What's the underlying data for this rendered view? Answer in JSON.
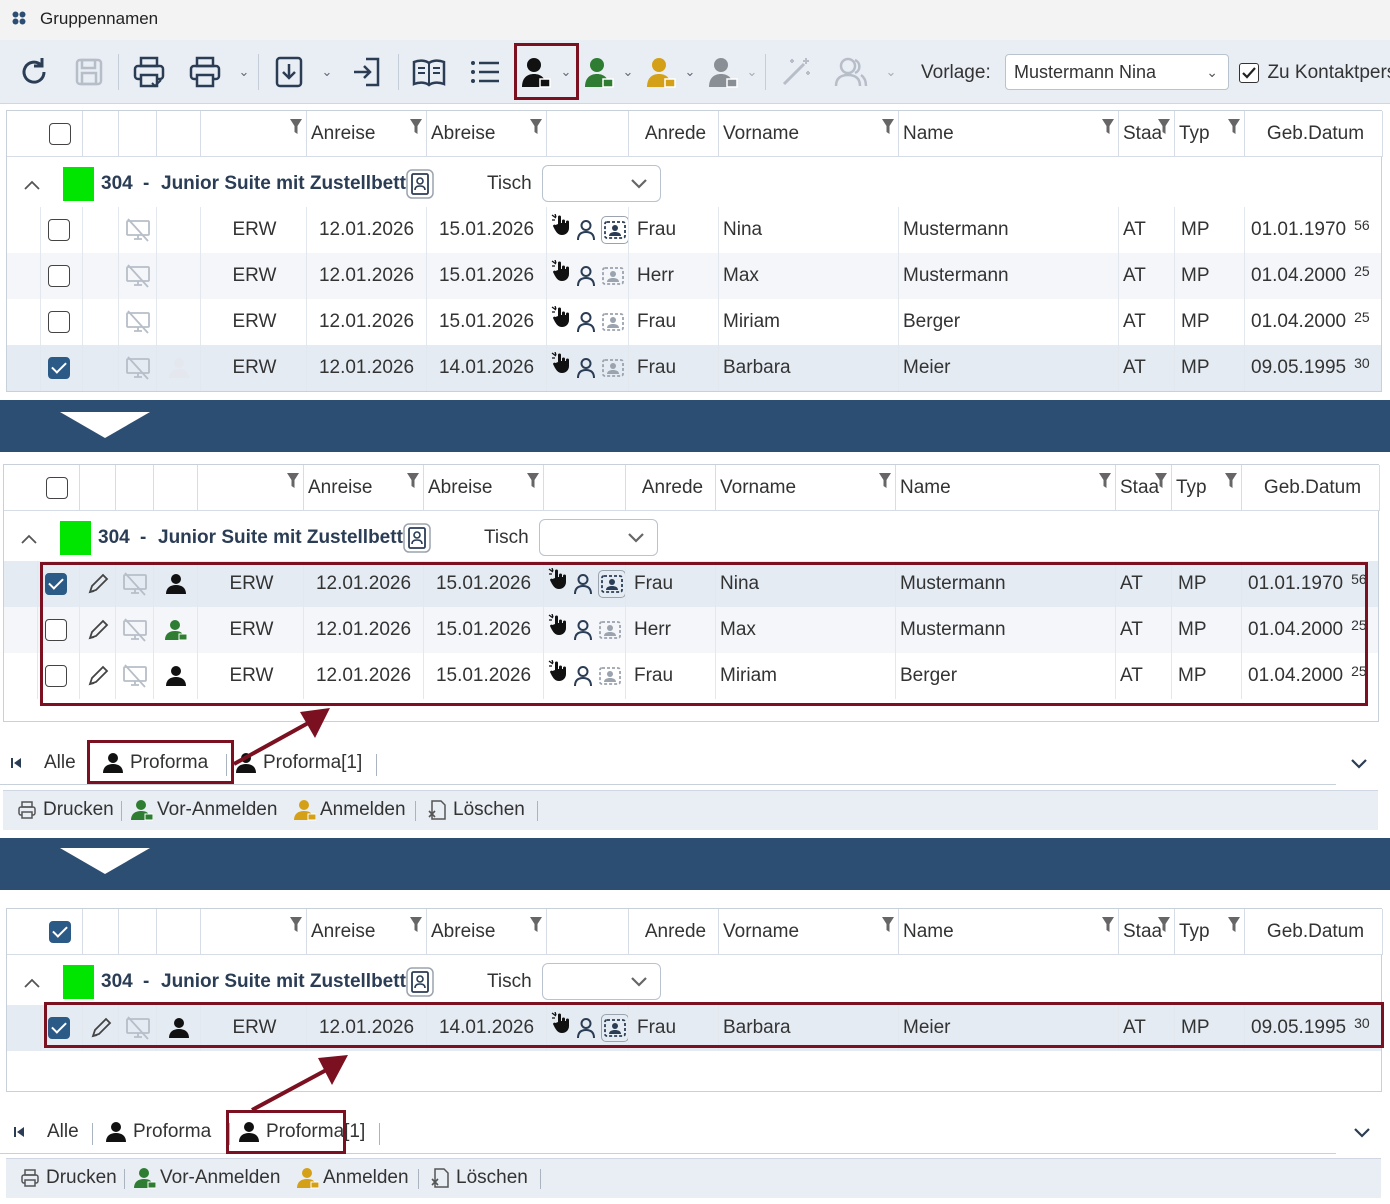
{
  "window": {
    "title": "Gruppennamen"
  },
  "toolbar": {
    "vorlage_label": "Vorlage:",
    "vorlage_value": "Mustermann Nina",
    "contact_label": "Zu Kontaktpers",
    "contact_checked": true
  },
  "columns": [
    "Anreise",
    "Abreise",
    "Anrede",
    "Vorname",
    "Name",
    "Staa",
    "Typ",
    "Geb.Datum"
  ],
  "group": {
    "room": "304",
    "sep": "-",
    "name": "Junior Suite mit Zustellbett",
    "tisch_label": "Tisch",
    "color": "#00e600"
  },
  "panel1": {
    "rows": [
      {
        "checked": false,
        "typ": "ERW",
        "anreise": "12.01.2026",
        "abreise": "15.01.2026",
        "anrede": "Frau",
        "vorname": "Nina",
        "name": "Mustermann",
        "staat": "AT",
        "mp": "MP",
        "geb": "01.01.1970",
        "age": "56"
      },
      {
        "checked": false,
        "typ": "ERW",
        "anreise": "12.01.2026",
        "abreise": "15.01.2026",
        "anrede": "Herr",
        "vorname": "Max",
        "name": "Mustermann",
        "staat": "AT",
        "mp": "MP",
        "geb": "01.04.2000",
        "age": "25"
      },
      {
        "checked": false,
        "typ": "ERW",
        "anreise": "12.01.2026",
        "abreise": "15.01.2026",
        "anrede": "Frau",
        "vorname": "Miriam",
        "name": "Berger",
        "staat": "AT",
        "mp": "MP",
        "geb": "01.04.2000",
        "age": "25"
      },
      {
        "checked": true,
        "typ": "ERW",
        "anreise": "12.01.2026",
        "abreise": "14.01.2026",
        "anrede": "Frau",
        "vorname": "Barbara",
        "name": "Meier",
        "staat": "AT",
        "mp": "MP",
        "geb": "09.05.1995",
        "age": "30"
      }
    ]
  },
  "panel2": {
    "rows": [
      {
        "checked": true,
        "typ": "ERW",
        "anreise": "12.01.2026",
        "abreise": "15.01.2026",
        "anrede": "Frau",
        "vorname": "Nina",
        "name": "Mustermann",
        "staat": "AT",
        "mp": "MP",
        "geb": "01.01.1970",
        "age": "56"
      },
      {
        "checked": false,
        "typ": "ERW",
        "anreise": "12.01.2026",
        "abreise": "15.01.2026",
        "anrede": "Herr",
        "vorname": "Max",
        "name": "Mustermann",
        "staat": "AT",
        "mp": "MP",
        "geb": "01.04.2000",
        "age": "25"
      },
      {
        "checked": false,
        "typ": "ERW",
        "anreise": "12.01.2026",
        "abreise": "15.01.2026",
        "anrede": "Frau",
        "vorname": "Miriam",
        "name": "Berger",
        "staat": "AT",
        "mp": "MP",
        "geb": "01.04.2000",
        "age": "25"
      }
    ]
  },
  "panel3": {
    "rows": [
      {
        "checked": true,
        "typ": "ERW",
        "anreise": "12.01.2026",
        "abreise": "14.01.2026",
        "anrede": "Frau",
        "vorname": "Barbara",
        "name": "Meier",
        "staat": "AT",
        "mp": "MP",
        "geb": "09.05.1995",
        "age": "30"
      }
    ]
  },
  "tabs": {
    "all": "Alle",
    "proforma": "Proforma",
    "proforma1": "Proforma[1]"
  },
  "actions": {
    "print": "Drucken",
    "pre_register": "Vor-Anmelden",
    "register": "Anmelden",
    "delete": "Löschen"
  },
  "colors": {
    "accent": "#2d4e73",
    "highlight": "#7b1020",
    "green_icon": "#2e7d32",
    "gold_icon": "#d4a017"
  }
}
